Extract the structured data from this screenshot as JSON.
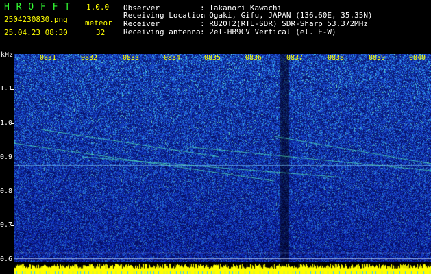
{
  "app": {
    "title": "H R O F F T",
    "version": "1.0.0",
    "filename": "2504230830.png",
    "datetime": "25.04.23 08:30",
    "mode_label": "meteor",
    "count": "32"
  },
  "info": {
    "rows": [
      {
        "label": "Observer",
        "value": ": Takanori Kawachi"
      },
      {
        "label": "Receiving Location",
        "value": ": Ogaki, Gifu, JAPAN (136.60E, 35.35N)"
      },
      {
        "label": "Receiver",
        "value": ": R820T2(RTL-SDR) SDR-Sharp 53.372MHz"
      },
      {
        "label": "Receiving antenna",
        "value": ": 2el-HB9CV Vertical (el. E-W)"
      }
    ]
  },
  "axis": {
    "unit": "kHz",
    "y_ticks": [
      "1.1",
      "1.0",
      "0.9",
      "0.8",
      "0.7",
      "0.6"
    ],
    "x_ticks": [
      "0831",
      "0832",
      "0833",
      "0834",
      "0835",
      "0836",
      "0837",
      "0838",
      "0839",
      "0840"
    ]
  },
  "colors": {
    "background": "#000000",
    "noise_dark": "#0a1a8c",
    "noise_mid": "#1e5adc",
    "signal": "#33ffcc",
    "level": "#ffff00",
    "text_white": "#ffffff",
    "text_yellow": "#ffff00",
    "text_green": "#33ff33"
  }
}
